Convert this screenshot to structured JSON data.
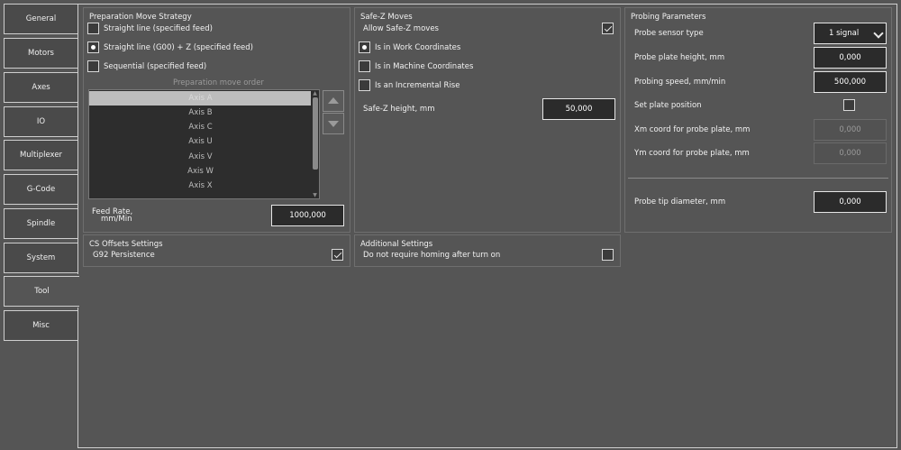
{
  "tabs": [
    {
      "label": "General"
    },
    {
      "label": "Motors"
    },
    {
      "label": "Axes"
    },
    {
      "label": "IO"
    },
    {
      "label": "Multiplexer"
    },
    {
      "label": "G-Code"
    },
    {
      "label": "Spindle"
    },
    {
      "label": "System"
    },
    {
      "label": "Tool",
      "active": true
    },
    {
      "label": "Misc"
    }
  ],
  "prep": {
    "title": "Preparation Move Strategy",
    "options": [
      {
        "label": "Straight line (specified feed)",
        "checked": false
      },
      {
        "label": "Straight line (G00) + Z (specified feed)",
        "checked": true
      },
      {
        "label": "Sequential (specified feed)",
        "checked": false
      }
    ],
    "order_caption": "Preparation move order",
    "order_items": [
      "Axis A",
      "Axis B",
      "Axis C",
      "Axis U",
      "Axis V",
      "Axis W",
      "Axis X"
    ],
    "selected_item": "Axis A",
    "feed_label_1": "Feed Rate,",
    "feed_label_2": "mm/Min",
    "feed_value": "1000,000"
  },
  "safez": {
    "title": "Safe-Z Moves",
    "allow_label": "Allow Safe-Z moves",
    "allow_checked": true,
    "options": [
      {
        "label": "Is in Work Coordinates",
        "checked": true
      },
      {
        "label": "Is in Machine Coordinates",
        "checked": false
      },
      {
        "label": "Is an Incremental Rise",
        "checked": false
      }
    ],
    "height_label": "Safe-Z height, mm",
    "height_value": "50,000"
  },
  "probing": {
    "title": "Probing Parameters",
    "sensor_type_label": "Probe sensor type",
    "sensor_type_value": "1 signal",
    "plate_height_label": "Probe plate height, mm",
    "plate_height_value": "0,000",
    "speed_label": "Probing speed, mm/min",
    "speed_value": "500,000",
    "set_plate_label": "Set plate position",
    "set_plate_checked": false,
    "xm_label": "Xm coord for probe plate, mm",
    "xm_value": "0,000",
    "ym_label": "Ym coord for probe plate, mm",
    "ym_value": "0,000",
    "tip_label": "Probe tip diameter, mm",
    "tip_value": "0,000"
  },
  "cs_offsets": {
    "title": "CS Offsets Settings",
    "g92_label": "G92 Persistence",
    "g92_checked": true
  },
  "additional": {
    "title": "Additional Settings",
    "homing_label": "Do not require homing after turn on",
    "homing_checked": false
  }
}
